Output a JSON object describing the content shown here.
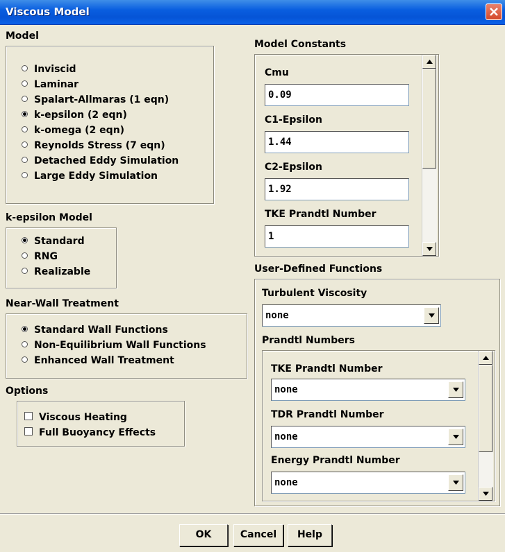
{
  "window": {
    "title": "Viscous Model"
  },
  "model": {
    "heading": "Model",
    "options": [
      {
        "label": "Inviscid",
        "selected": false
      },
      {
        "label": "Laminar",
        "selected": false
      },
      {
        "label": "Spalart-Allmaras  (1 eqn)",
        "selected": false
      },
      {
        "label": "k-epsilon  (2 eqn)",
        "selected": true
      },
      {
        "label": "k-omega  (2 eqn)",
        "selected": false
      },
      {
        "label": "Reynolds Stress  (7 eqn)",
        "selected": false
      },
      {
        "label": "Detached Eddy Simulation",
        "selected": false
      },
      {
        "label": "Large Eddy Simulation",
        "selected": false
      }
    ]
  },
  "kepsilon_model": {
    "heading": "k-epsilon Model",
    "options": [
      {
        "label": "Standard",
        "selected": true
      },
      {
        "label": "RNG",
        "selected": false
      },
      {
        "label": "Realizable",
        "selected": false
      }
    ]
  },
  "near_wall": {
    "heading": "Near-Wall Treatment",
    "options": [
      {
        "label": "Standard Wall Functions",
        "selected": true
      },
      {
        "label": "Non-Equilibrium Wall Functions",
        "selected": false
      },
      {
        "label": "Enhanced Wall Treatment",
        "selected": false
      }
    ]
  },
  "options": {
    "heading": "Options",
    "items": [
      {
        "label": "Viscous Heating",
        "checked": false
      },
      {
        "label": "Full Buoyancy Effects",
        "checked": false
      }
    ]
  },
  "model_constants": {
    "heading": "Model Constants",
    "fields": [
      {
        "label": "Cmu",
        "value": "0.09"
      },
      {
        "label": "C1-Epsilon",
        "value": "1.44"
      },
      {
        "label": "C2-Epsilon",
        "value": "1.92"
      },
      {
        "label": "TKE Prandtl Number",
        "value": "1"
      }
    ]
  },
  "udf": {
    "heading": "User-Defined Functions",
    "turbulent_viscosity": {
      "label": "Turbulent Viscosity",
      "value": "none"
    },
    "prandtl_heading": "Prandtl Numbers",
    "prandtl": [
      {
        "label": "TKE Prandtl Number",
        "value": "none"
      },
      {
        "label": "TDR Prandtl Number",
        "value": "none"
      },
      {
        "label": "Energy Prandtl Number",
        "value": "none"
      }
    ]
  },
  "buttons": {
    "ok": "OK",
    "cancel": "Cancel",
    "help": "Help"
  }
}
